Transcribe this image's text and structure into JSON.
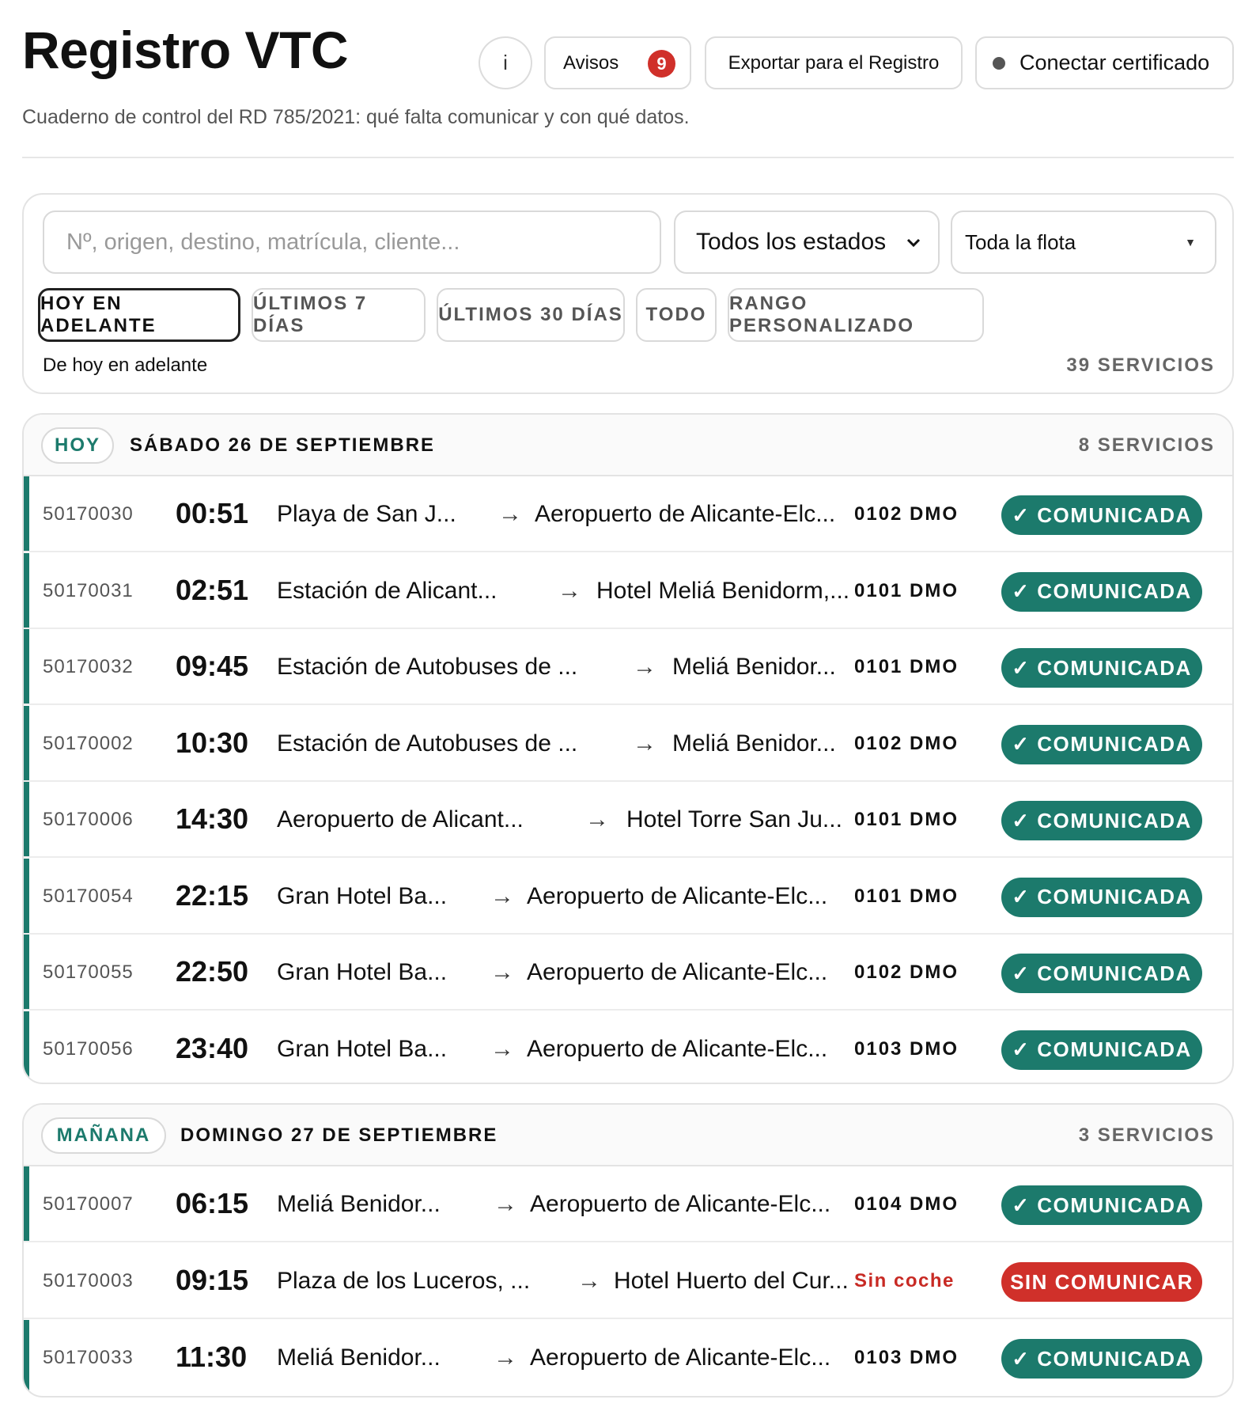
{
  "header": {
    "title": "Registro VTC",
    "subtitle": "Cuaderno de control del RD 785/2021: qué falta comunicar y con qué datos.",
    "info_label": "i",
    "avisos_label": "Avisos",
    "avisos_count": "9",
    "export_label": "Exportar para el Registro",
    "cert_label": "Conectar certificado"
  },
  "filters": {
    "search_placeholder": "Nº, origen, destino, matrícula, cliente...",
    "estado_value": "Todos los estados",
    "flota_value": "Toda la flota",
    "chips": [
      "HOY EN ADELANTE",
      "ÚLTIMOS 7 DÍAS",
      "ÚLTIMOS 30 DÍAS",
      "TODO",
      "RANGO PERSONALIZADO"
    ],
    "active_chip": "HOY EN ADELANTE",
    "range_label": "De hoy en adelante",
    "total_count": "39 SERVICIOS"
  },
  "groups": [
    {
      "chip": "HOY",
      "date": "SÁBADO 26 DE SEPTIEMBRE",
      "count": "8 SERVICIOS",
      "rows": [
        {
          "num": "50170030",
          "time": "00:51",
          "origin": "Playa de San J...",
          "arrow": "→",
          "dest": "Aeropuerto de Alicante-Elc...",
          "plate": "0102 DMO",
          "status": "✓ COMUNICADA"
        },
        {
          "num": "50170031",
          "time": "02:51",
          "origin": "Estación de Alicant...",
          "arrow": "→",
          "dest": "Hotel Meliá Benidorm,...",
          "plate": "0101 DMO",
          "status": "✓ COMUNICADA"
        },
        {
          "num": "50170032",
          "time": "09:45",
          "origin": "Estación de Autobuses de ...",
          "arrow": "→",
          "dest": "Meliá Benidor...",
          "plate": "0101 DMO",
          "status": "✓ COMUNICADA"
        },
        {
          "num": "50170002",
          "time": "10:30",
          "origin": "Estación de Autobuses de ...",
          "arrow": "→",
          "dest": "Meliá Benidor...",
          "plate": "0102 DMO",
          "status": "✓ COMUNICADA"
        },
        {
          "num": "50170006",
          "time": "14:30",
          "origin": "Aeropuerto de Alicant...",
          "arrow": "→",
          "dest": "Hotel Torre San Ju...",
          "plate": "0101 DMO",
          "status": "✓ COMUNICADA"
        },
        {
          "num": "50170054",
          "time": "22:15",
          "origin": "Gran Hotel Ba...",
          "arrow": "→",
          "dest": "Aeropuerto de Alicante-Elc...",
          "plate": "0101 DMO",
          "status": "✓ COMUNICADA"
        },
        {
          "num": "50170055",
          "time": "22:50",
          "origin": "Gran Hotel Ba...",
          "arrow": "→",
          "dest": "Aeropuerto de Alicante-Elc...",
          "plate": "0102 DMO",
          "status": "✓ COMUNICADA"
        },
        {
          "num": "50170056",
          "time": "23:40",
          "origin": "Gran Hotel Ba...",
          "arrow": "→",
          "dest": "Aeropuerto de Alicante-Elc...",
          "plate": "0103 DMO",
          "status": "✓ COMUNICADA"
        }
      ]
    },
    {
      "chip": "MAÑANA",
      "date": "DOMINGO 27 DE SEPTIEMBRE",
      "count": "3 SERVICIOS",
      "rows": [
        {
          "num": "50170007",
          "time": "06:15",
          "origin": "Meliá Benidor...",
          "arrow": "→",
          "dest": "Aeropuerto de Alicante-Elc...",
          "plate": "0104 DMO",
          "status": "✓ COMUNICADA"
        },
        {
          "num": "50170003",
          "time": "09:15",
          "origin": "Plaza de los Luceros, ...",
          "arrow": "→",
          "dest": "Hotel Huerto del Cur...",
          "plate": "Sin coche",
          "status": "SIN COMUNICAR"
        },
        {
          "num": "50170033",
          "time": "11:30",
          "origin": "Meliá Benidor...",
          "arrow": "→",
          "dest": "Aeropuerto de Alicante-Elc...",
          "plate": "0103 DMO",
          "status": "✓ COMUNICADA"
        }
      ]
    }
  ],
  "colors": {
    "accent": "#1c7a6c",
    "danger": "#d0302a"
  },
  "icons": {
    "info": "info-icon",
    "cert_status": "status-dot-icon",
    "select_chevron": "chevron-down-icon",
    "route_arrow": "arrow-right-icon"
  }
}
